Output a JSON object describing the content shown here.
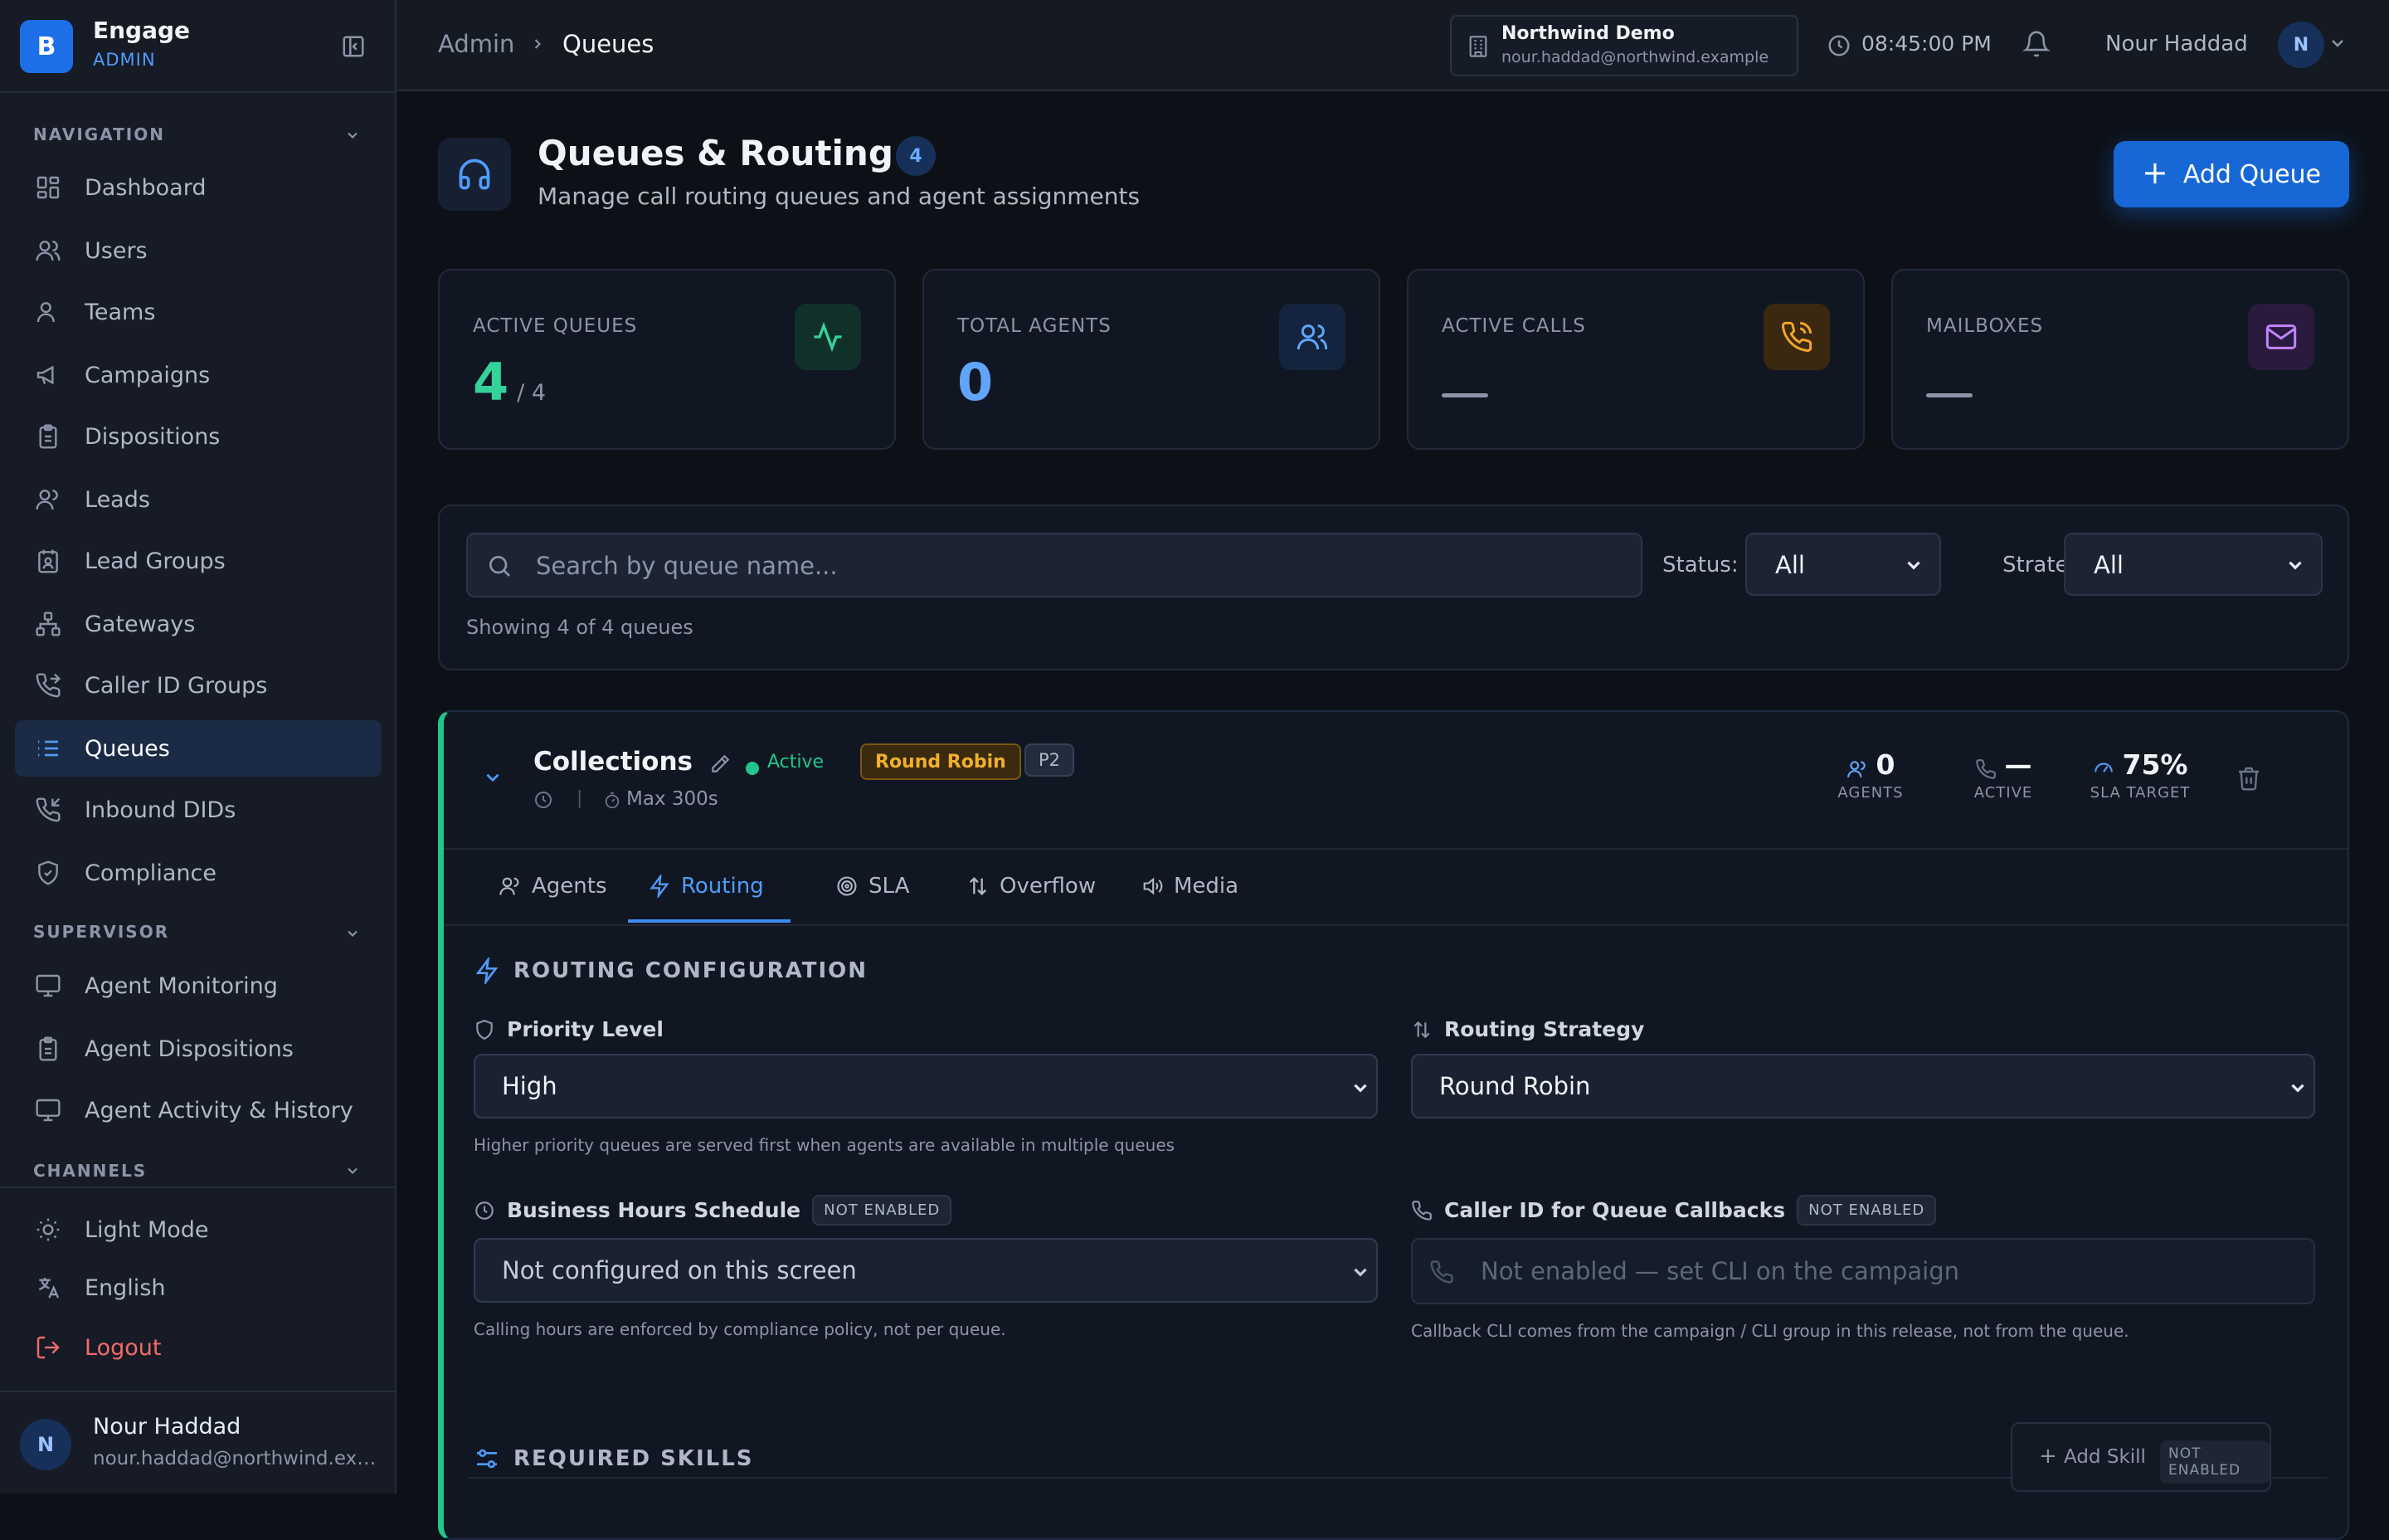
{
  "brand": {
    "logo_letter": "B",
    "name": "Engage",
    "role": "ADMIN"
  },
  "sidebar": {
    "sections": {
      "navigation": "NAVIGATION",
      "supervisor": "SUPERVISOR",
      "channels": "CHANNELS"
    },
    "navigation": [
      {
        "label": "Dashboard",
        "icon": "dashboard-icon"
      },
      {
        "label": "Users",
        "icon": "users-icon"
      },
      {
        "label": "Teams",
        "icon": "teams-icon"
      },
      {
        "label": "Campaigns",
        "icon": "megaphone-icon"
      },
      {
        "label": "Dispositions",
        "icon": "clipboard-icon"
      },
      {
        "label": "Leads",
        "icon": "leads-icon"
      },
      {
        "label": "Lead Groups",
        "icon": "lead-groups-icon"
      },
      {
        "label": "Gateways",
        "icon": "network-icon"
      },
      {
        "label": "Caller ID Groups",
        "icon": "phone-forward-icon"
      },
      {
        "label": "Queues",
        "icon": "list-icon",
        "active": true
      },
      {
        "label": "Inbound DIDs",
        "icon": "phone-incoming-icon"
      },
      {
        "label": "Compliance",
        "icon": "shield-check-icon"
      }
    ],
    "supervisor": [
      {
        "label": "Agent Monitoring",
        "icon": "monitor-icon"
      },
      {
        "label": "Agent Dispositions",
        "icon": "clipboard-icon"
      },
      {
        "label": "Agent Activity & History",
        "icon": "monitor-icon"
      }
    ],
    "bottom": {
      "light_mode": "Light Mode",
      "language": "English",
      "logout": "Logout"
    },
    "user": {
      "initial": "N",
      "name": "Nour Haddad",
      "email": "nour.haddad@northwind.example"
    }
  },
  "topbar": {
    "breadcrumb": [
      "Admin",
      "Queues"
    ],
    "tenant": {
      "name": "Northwind Demo",
      "email": "nour.haddad@northwind.example"
    },
    "clock": "08:45:00 PM",
    "user": {
      "name": "Nour Haddad",
      "initial": "N"
    }
  },
  "page": {
    "title": "Queues & Routing",
    "count": "4",
    "subtitle": "Manage call routing queues and agent assignments",
    "add_button": "Add Queue"
  },
  "stats": [
    {
      "label": "ACTIVE QUEUES",
      "value": "4",
      "sub": "/ 4",
      "color": "#34d399",
      "icon": "activity-icon"
    },
    {
      "label": "TOTAL AGENTS",
      "value": "0",
      "color": "#60a5fa",
      "icon": "users-icon"
    },
    {
      "label": "ACTIVE CALLS",
      "value": "—",
      "color": "#f5a524",
      "icon": "phone-call-icon"
    },
    {
      "label": "MAILBOXES",
      "value": "—",
      "color": "#c084fc",
      "icon": "mail-icon"
    }
  ],
  "filters": {
    "search_placeholder": "Search by queue name...",
    "status_label": "Status:",
    "status_value": "All",
    "strategy_label": "Strategy:",
    "strategy_value": "All",
    "showing": "Showing 4 of 4 queues"
  },
  "queue": {
    "name": "Collections",
    "status": "Active",
    "strategy": "Round Robin",
    "priority_badge": "P2",
    "max_wait": "Max 300s",
    "metrics": {
      "agents": {
        "value": "0",
        "label": "AGENTS"
      },
      "active": {
        "value": "—",
        "label": "ACTIVE"
      },
      "sla": {
        "value": "75%",
        "label": "SLA TARGET"
      }
    },
    "tabs": [
      "Agents",
      "Routing",
      "SLA",
      "Overflow",
      "Media"
    ],
    "active_tab": "Routing",
    "routing": {
      "section_title": "ROUTING CONFIGURATION",
      "priority_label": "Priority Level",
      "priority_value": "High",
      "priority_help": "Higher priority queues are served first when agents are available in multiple queues",
      "strategy_label": "Routing Strategy",
      "strategy_value": "Round Robin",
      "hours_label": "Business Hours Schedule",
      "hours_badge": "NOT ENABLED",
      "hours_value": "Not configured on this screen",
      "hours_help": "Calling hours are enforced by compliance policy, not per queue.",
      "cli_label": "Caller ID for Queue Callbacks",
      "cli_badge": "NOT ENABLED",
      "cli_placeholder": "Not enabled — set CLI on the campaign",
      "cli_help": "Callback CLI comes from the campaign / CLI group in this release, not from the queue."
    },
    "skills": {
      "section_title": "REQUIRED SKILLS",
      "add_label": "Add Skill",
      "add_badge": "NOT ENABLED"
    }
  }
}
